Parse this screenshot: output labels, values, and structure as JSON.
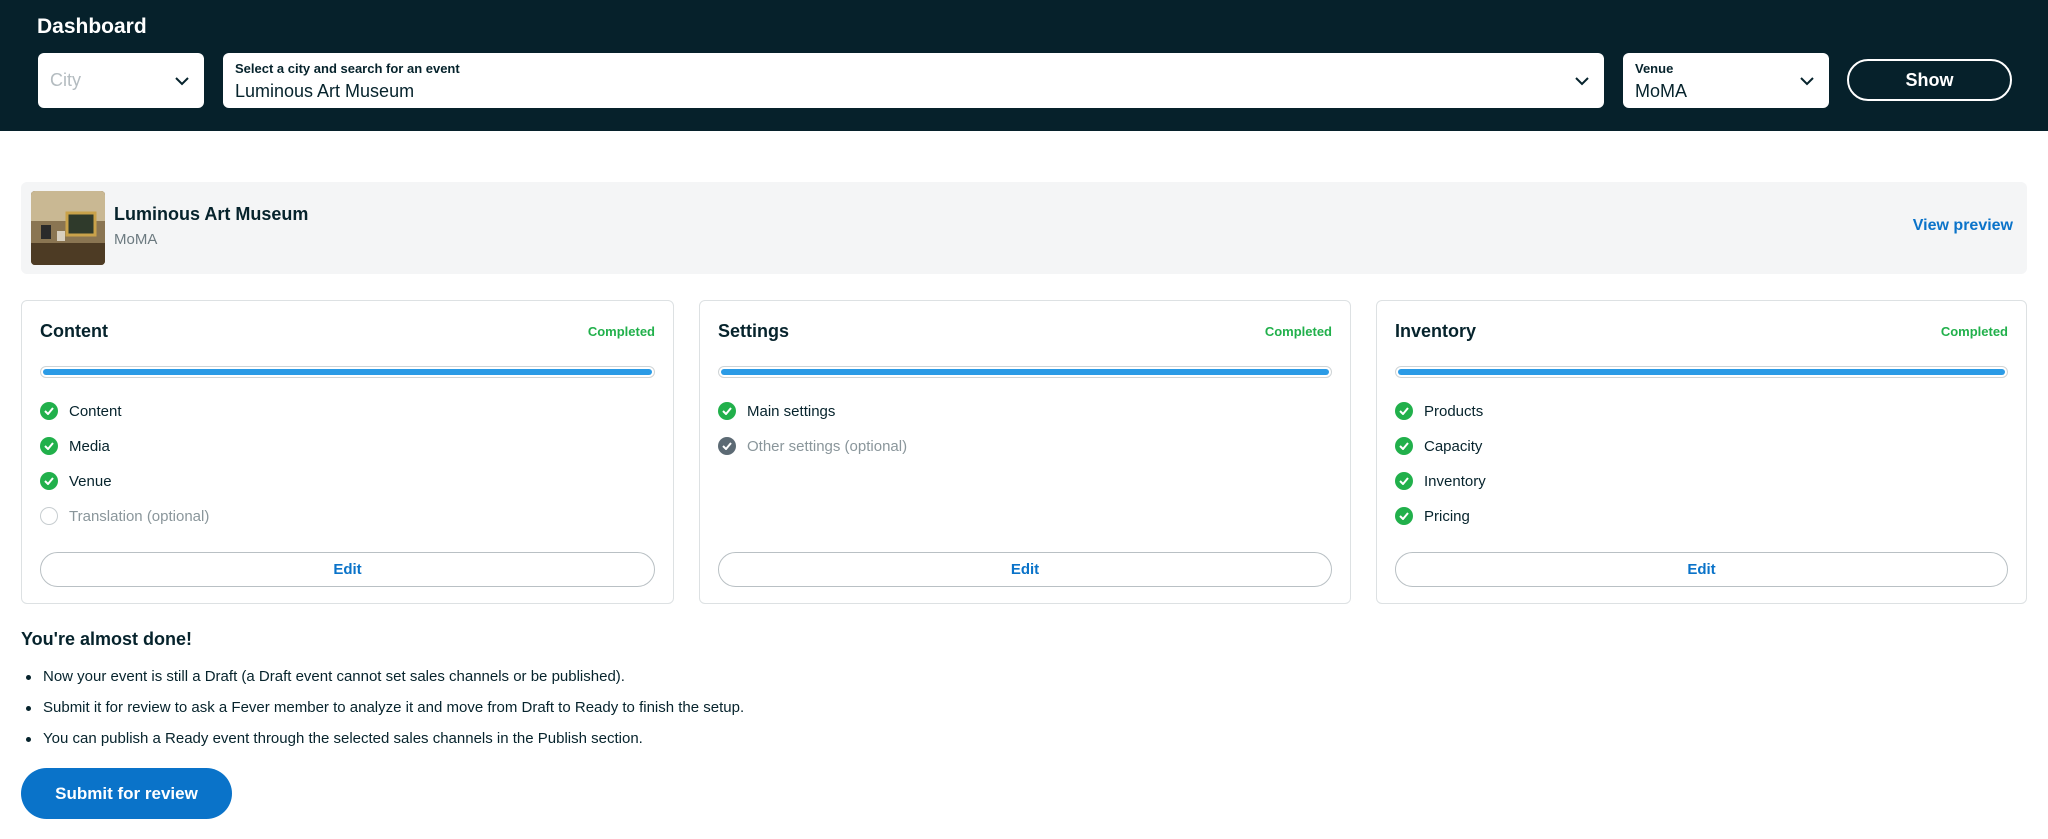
{
  "header": {
    "title": "Dashboard",
    "city": {
      "placeholder": "City"
    },
    "event_search": {
      "label": "Select a city and search for an event",
      "value": "Luminous Art Museum"
    },
    "venue": {
      "label": "Venue",
      "value": "MoMA"
    },
    "show_label": "Show"
  },
  "event": {
    "name": "Luminous Art Museum",
    "venue": "MoMA",
    "view_preview": "View preview"
  },
  "cards": [
    {
      "title": "Content",
      "status": "Completed",
      "progress": 1.0,
      "items": [
        {
          "label": "Content",
          "state": "done"
        },
        {
          "label": "Media",
          "state": "done"
        },
        {
          "label": "Venue",
          "state": "done"
        },
        {
          "label": "Translation (optional)",
          "state": "empty"
        }
      ],
      "edit_label": "Edit"
    },
    {
      "title": "Settings",
      "status": "Completed",
      "progress": 1.0,
      "items": [
        {
          "label": "Main settings",
          "state": "done"
        },
        {
          "label": "Other settings (optional)",
          "state": "optional-done"
        }
      ],
      "edit_label": "Edit"
    },
    {
      "title": "Inventory",
      "status": "Completed",
      "progress": 1.0,
      "items": [
        {
          "label": "Products",
          "state": "done"
        },
        {
          "label": "Capacity",
          "state": "done"
        },
        {
          "label": "Inventory",
          "state": "done"
        },
        {
          "label": "Pricing",
          "state": "done"
        }
      ],
      "edit_label": "Edit"
    }
  ],
  "info": {
    "heading": "You're almost done!",
    "bullets": [
      "Now your event is still a Draft (a Draft event cannot set sales channels or be published).",
      "Submit it for review to ask a Fever member to analyze it and move from Draft to Ready to finish the setup.",
      "You can publish a Ready event through the selected sales channels in the Publish section."
    ]
  },
  "submit_label": "Submit for review",
  "colors": {
    "header_bg": "#06212b",
    "accent_blue": "#0a73c9",
    "success_green": "#21b04b",
    "progress_blue": "#2b9be6"
  }
}
